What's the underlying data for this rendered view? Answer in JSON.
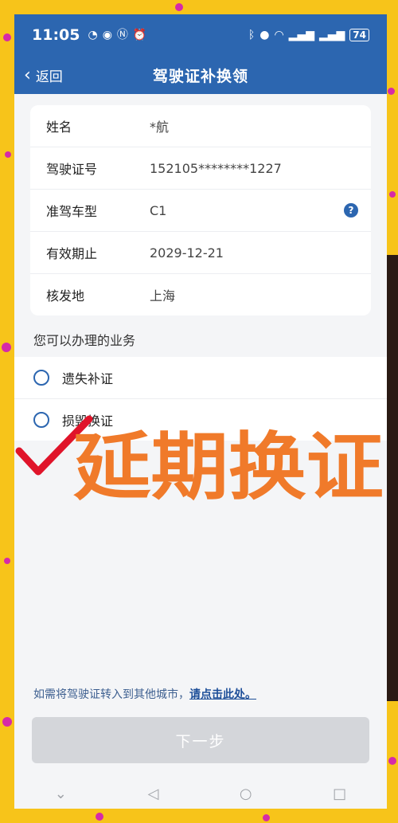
{
  "status_bar": {
    "time": "11:05",
    "battery": "74"
  },
  "nav": {
    "back_label": "返回",
    "title": "驾驶证补换领"
  },
  "license_info": [
    {
      "label": "姓名",
      "value": "*航"
    },
    {
      "label": "驾驶证号",
      "value": "152105********1227"
    },
    {
      "label": "准驾车型",
      "value": "C1"
    },
    {
      "label": "有效期止",
      "value": "2029-12-21"
    },
    {
      "label": "核发地",
      "value": "上海"
    }
  ],
  "services": {
    "title": "您可以办理的业务",
    "items": [
      "遗失补证",
      "损毁换证"
    ]
  },
  "handwritten_annotation": "延期换证",
  "transfer": {
    "text": "如需将驾驶证转入到其他城市，",
    "link": "请点击此处。"
  },
  "next_button": "下一步",
  "colors": {
    "header": "#2c66b0",
    "background": "#f7c41a",
    "annotation": "#f07a2a",
    "check": "#e0142a"
  }
}
